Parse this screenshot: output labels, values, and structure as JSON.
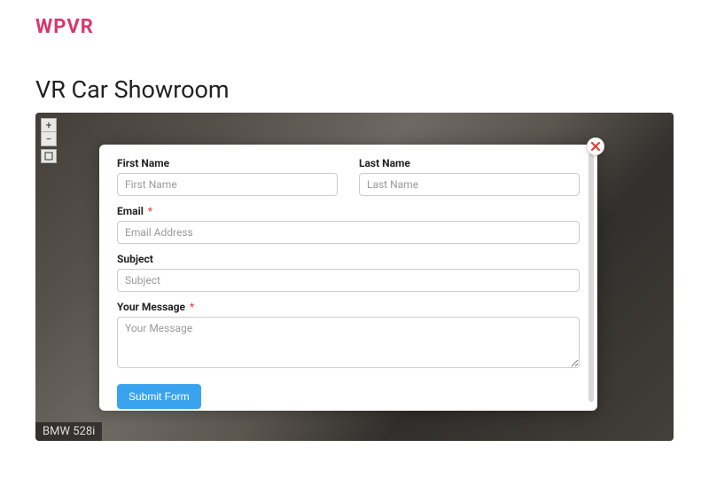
{
  "brand": "WPVR",
  "page_title": "VR Car Showroom",
  "viewer": {
    "zoom_in": "+",
    "zoom_out": "−",
    "caption": "BMW 528i"
  },
  "form": {
    "first_name": {
      "label": "First Name",
      "placeholder": "First Name"
    },
    "last_name": {
      "label": "Last Name",
      "placeholder": "Last Name"
    },
    "email": {
      "label": "Email",
      "required_mark": "*",
      "placeholder": "Email Address"
    },
    "subject": {
      "label": "Subject",
      "placeholder": "Subject"
    },
    "message": {
      "label": "Your Message",
      "required_mark": "*",
      "placeholder": "Your Message"
    },
    "submit_label": "Submit Form"
  }
}
